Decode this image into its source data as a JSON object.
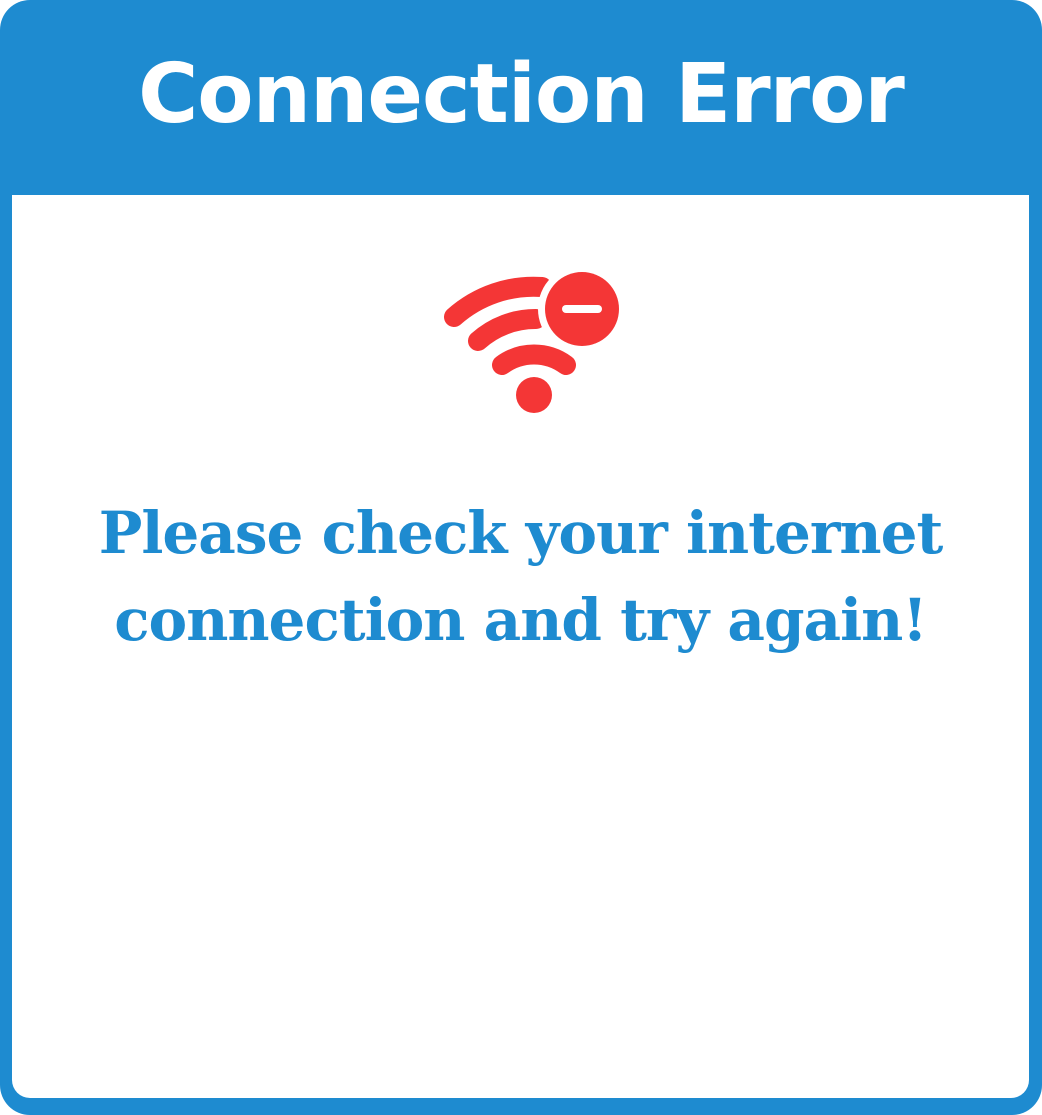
{
  "dialog": {
    "title": "Connection Error",
    "message": "Please check your internet connection and try again!",
    "icon": "wifi-error-icon"
  },
  "colors": {
    "frame": "#1e8bd0",
    "background": "#ffffff",
    "title_text": "#ffffff",
    "message_text": "#1e8bd0",
    "icon": "#f43636"
  }
}
